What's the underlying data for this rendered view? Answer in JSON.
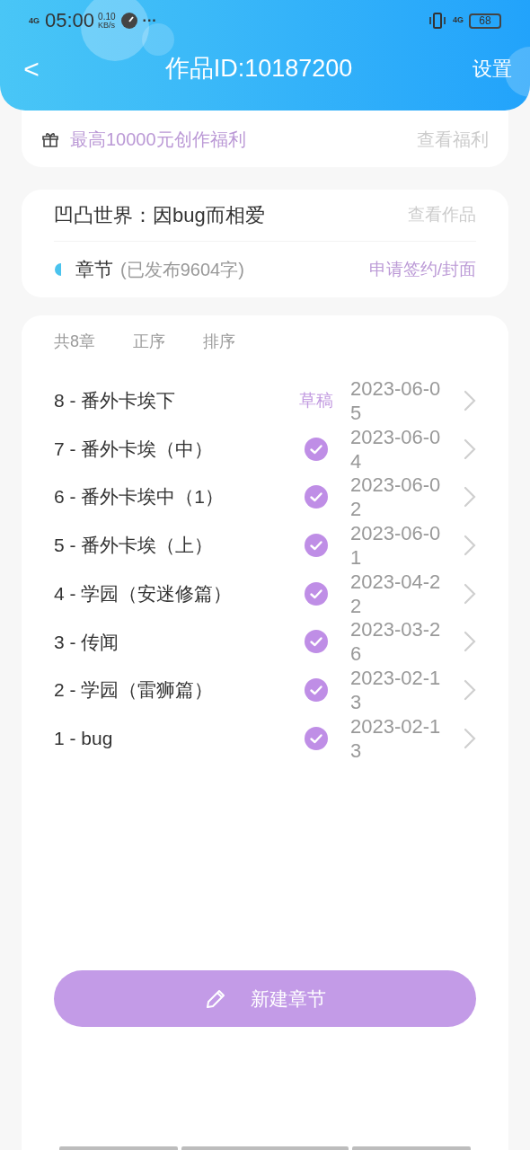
{
  "status_bar": {
    "network": "4G",
    "time": "05:00",
    "speed": "0.10",
    "speed_unit": "KB/s",
    "more": "···",
    "data": "4G",
    "battery": "68"
  },
  "header": {
    "back": "<",
    "title": "作品ID:10187200",
    "settings": "设置"
  },
  "promo": {
    "text": "最高10000元创作福利",
    "link": "查看福利"
  },
  "work": {
    "title": "凹凸世界：因bug而相爱",
    "view": "查看作品",
    "section": "章节",
    "published": "(已发布9604字)",
    "apply": "申请签约/封面"
  },
  "toolbar": [
    "共8章",
    "正序",
    "排序"
  ],
  "chapters": [
    {
      "title": "8 - 番外卡埃下",
      "kind": "draft",
      "badge": "草稿",
      "date": "2023-06-05"
    },
    {
      "title": "7 - 番外卡埃（中）",
      "kind": "published",
      "date": "2023-06-04"
    },
    {
      "title": "6 - 番外卡埃中（1）",
      "kind": "published",
      "date": "2023-06-02"
    },
    {
      "title": "5 - 番外卡埃（上）",
      "kind": "published",
      "date": "2023-06-01"
    },
    {
      "title": "4 - 学园（安迷修篇）",
      "kind": "published",
      "date": "2023-04-22"
    },
    {
      "title": "3 - 传闻",
      "kind": "published",
      "date": "2023-03-26"
    },
    {
      "title": "2 - 学园（雷狮篇）",
      "kind": "published",
      "date": "2023-02-13"
    },
    {
      "title": "1 - bug",
      "kind": "published",
      "date": "2023-02-13"
    }
  ],
  "new_chapter": "新建章节"
}
